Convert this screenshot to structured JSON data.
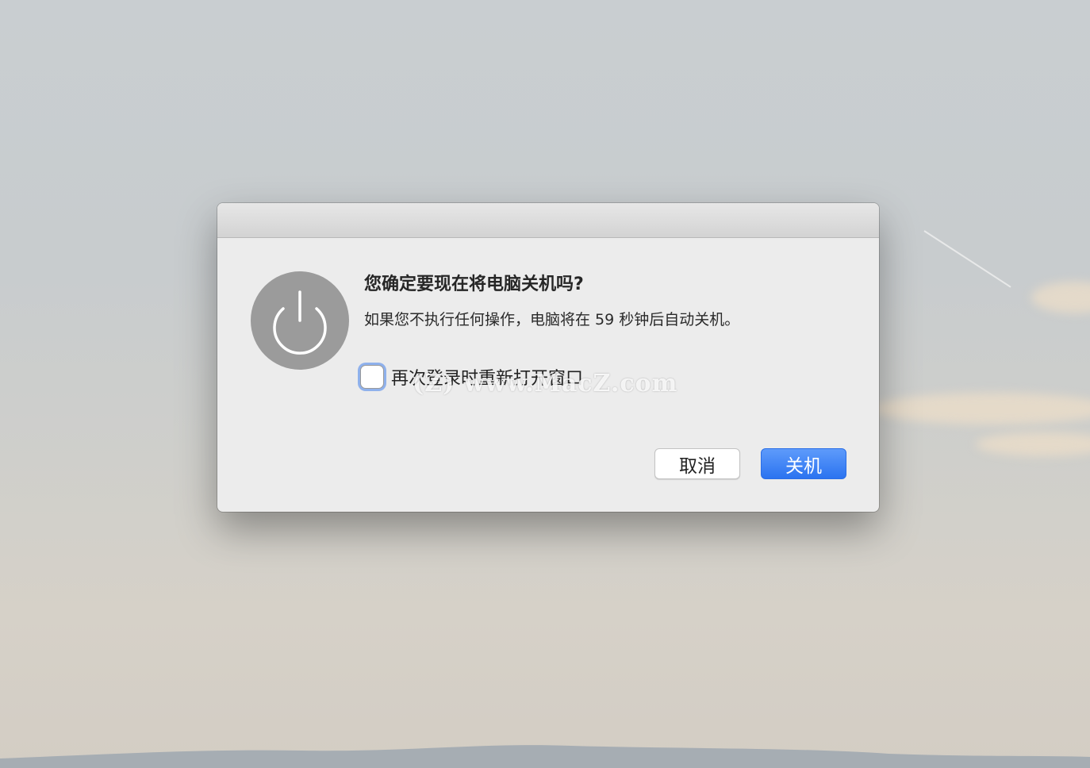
{
  "dialog": {
    "title": "您确定要现在将电脑关机吗?",
    "message": "如果您不执行任何操作，电脑将在 59 秒钟后自动关机。",
    "checkbox": {
      "label": "再次登录时重新打开窗口",
      "checked": false
    },
    "buttons": {
      "cancel": "取消",
      "shutdown": "关机"
    },
    "icon": "power-icon"
  },
  "watermark": "(Z) www.MacZ.com",
  "colors": {
    "accent": "#2b73f0",
    "dialog_bg": "#ececec",
    "icon_bg": "#9b9b9b"
  }
}
